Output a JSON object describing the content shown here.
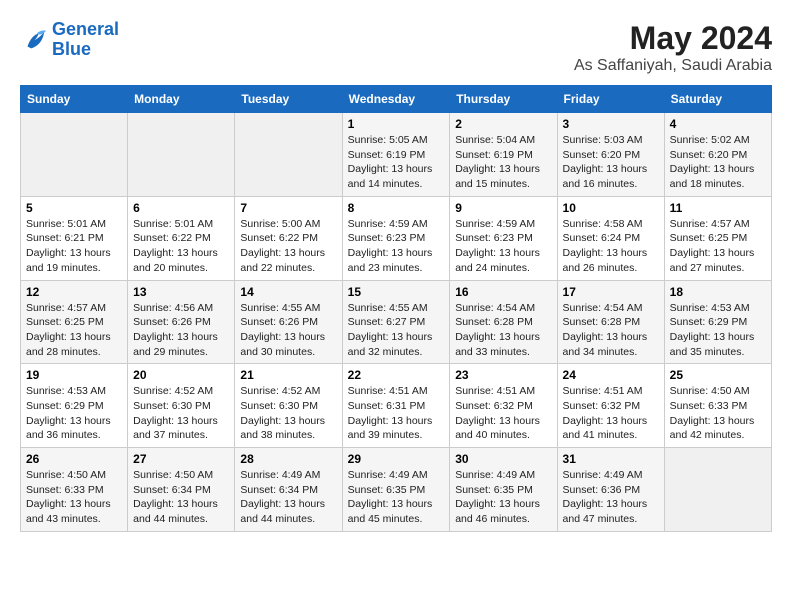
{
  "logo": {
    "line1": "General",
    "line2": "Blue"
  },
  "title": "May 2024",
  "subtitle": "As Saffaniyah, Saudi Arabia",
  "headers": [
    "Sunday",
    "Monday",
    "Tuesday",
    "Wednesday",
    "Thursday",
    "Friday",
    "Saturday"
  ],
  "weeks": [
    [
      {
        "num": "",
        "info": ""
      },
      {
        "num": "",
        "info": ""
      },
      {
        "num": "",
        "info": ""
      },
      {
        "num": "1",
        "info": "Sunrise: 5:05 AM\nSunset: 6:19 PM\nDaylight: 13 hours and 14 minutes."
      },
      {
        "num": "2",
        "info": "Sunrise: 5:04 AM\nSunset: 6:19 PM\nDaylight: 13 hours and 15 minutes."
      },
      {
        "num": "3",
        "info": "Sunrise: 5:03 AM\nSunset: 6:20 PM\nDaylight: 13 hours and 16 minutes."
      },
      {
        "num": "4",
        "info": "Sunrise: 5:02 AM\nSunset: 6:20 PM\nDaylight: 13 hours and 18 minutes."
      }
    ],
    [
      {
        "num": "5",
        "info": "Sunrise: 5:01 AM\nSunset: 6:21 PM\nDaylight: 13 hours and 19 minutes."
      },
      {
        "num": "6",
        "info": "Sunrise: 5:01 AM\nSunset: 6:22 PM\nDaylight: 13 hours and 20 minutes."
      },
      {
        "num": "7",
        "info": "Sunrise: 5:00 AM\nSunset: 6:22 PM\nDaylight: 13 hours and 22 minutes."
      },
      {
        "num": "8",
        "info": "Sunrise: 4:59 AM\nSunset: 6:23 PM\nDaylight: 13 hours and 23 minutes."
      },
      {
        "num": "9",
        "info": "Sunrise: 4:59 AM\nSunset: 6:23 PM\nDaylight: 13 hours and 24 minutes."
      },
      {
        "num": "10",
        "info": "Sunrise: 4:58 AM\nSunset: 6:24 PM\nDaylight: 13 hours and 26 minutes."
      },
      {
        "num": "11",
        "info": "Sunrise: 4:57 AM\nSunset: 6:25 PM\nDaylight: 13 hours and 27 minutes."
      }
    ],
    [
      {
        "num": "12",
        "info": "Sunrise: 4:57 AM\nSunset: 6:25 PM\nDaylight: 13 hours and 28 minutes."
      },
      {
        "num": "13",
        "info": "Sunrise: 4:56 AM\nSunset: 6:26 PM\nDaylight: 13 hours and 29 minutes."
      },
      {
        "num": "14",
        "info": "Sunrise: 4:55 AM\nSunset: 6:26 PM\nDaylight: 13 hours and 30 minutes."
      },
      {
        "num": "15",
        "info": "Sunrise: 4:55 AM\nSunset: 6:27 PM\nDaylight: 13 hours and 32 minutes."
      },
      {
        "num": "16",
        "info": "Sunrise: 4:54 AM\nSunset: 6:28 PM\nDaylight: 13 hours and 33 minutes."
      },
      {
        "num": "17",
        "info": "Sunrise: 4:54 AM\nSunset: 6:28 PM\nDaylight: 13 hours and 34 minutes."
      },
      {
        "num": "18",
        "info": "Sunrise: 4:53 AM\nSunset: 6:29 PM\nDaylight: 13 hours and 35 minutes."
      }
    ],
    [
      {
        "num": "19",
        "info": "Sunrise: 4:53 AM\nSunset: 6:29 PM\nDaylight: 13 hours and 36 minutes."
      },
      {
        "num": "20",
        "info": "Sunrise: 4:52 AM\nSunset: 6:30 PM\nDaylight: 13 hours and 37 minutes."
      },
      {
        "num": "21",
        "info": "Sunrise: 4:52 AM\nSunset: 6:30 PM\nDaylight: 13 hours and 38 minutes."
      },
      {
        "num": "22",
        "info": "Sunrise: 4:51 AM\nSunset: 6:31 PM\nDaylight: 13 hours and 39 minutes."
      },
      {
        "num": "23",
        "info": "Sunrise: 4:51 AM\nSunset: 6:32 PM\nDaylight: 13 hours and 40 minutes."
      },
      {
        "num": "24",
        "info": "Sunrise: 4:51 AM\nSunset: 6:32 PM\nDaylight: 13 hours and 41 minutes."
      },
      {
        "num": "25",
        "info": "Sunrise: 4:50 AM\nSunset: 6:33 PM\nDaylight: 13 hours and 42 minutes."
      }
    ],
    [
      {
        "num": "26",
        "info": "Sunrise: 4:50 AM\nSunset: 6:33 PM\nDaylight: 13 hours and 43 minutes."
      },
      {
        "num": "27",
        "info": "Sunrise: 4:50 AM\nSunset: 6:34 PM\nDaylight: 13 hours and 44 minutes."
      },
      {
        "num": "28",
        "info": "Sunrise: 4:49 AM\nSunset: 6:34 PM\nDaylight: 13 hours and 44 minutes."
      },
      {
        "num": "29",
        "info": "Sunrise: 4:49 AM\nSunset: 6:35 PM\nDaylight: 13 hours and 45 minutes."
      },
      {
        "num": "30",
        "info": "Sunrise: 4:49 AM\nSunset: 6:35 PM\nDaylight: 13 hours and 46 minutes."
      },
      {
        "num": "31",
        "info": "Sunrise: 4:49 AM\nSunset: 6:36 PM\nDaylight: 13 hours and 47 minutes."
      },
      {
        "num": "",
        "info": ""
      }
    ]
  ]
}
